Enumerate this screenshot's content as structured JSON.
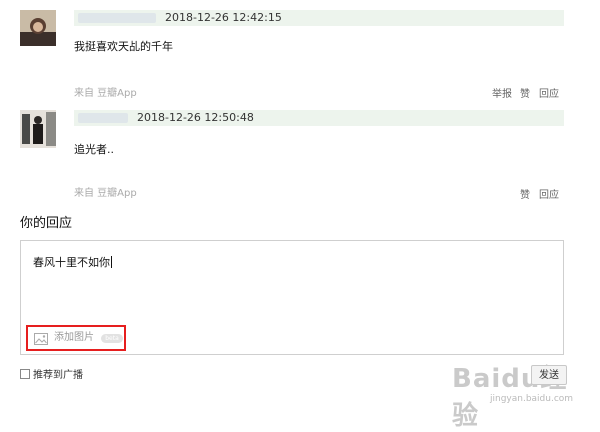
{
  "comments": [
    {
      "timestamp": "2018-12-26 12:42:15",
      "text": "我挺喜欢天乩的千年",
      "source": "来自 豆瓣App",
      "actions": [
        "举报",
        "赞",
        "回应"
      ]
    },
    {
      "timestamp": "2018-12-26 12:50:48",
      "text": "追光者..",
      "source": "来自 豆瓣App",
      "actions": [
        "赞",
        "回应"
      ]
    }
  ],
  "reply": {
    "section_title": "你的回应",
    "input_value": "春风十里不如你",
    "add_image_label": "添加图片",
    "beta_badge": "beta",
    "recommend_label": "推荐到广播",
    "send_label": "发送"
  },
  "watermark": {
    "brand": "Baidu经验",
    "url": "jingyan.baidu.com"
  },
  "colors": {
    "meta_bar": "#edf4ed",
    "highlight_border": "#e61e1e",
    "muted_text": "#aaaaaa"
  }
}
